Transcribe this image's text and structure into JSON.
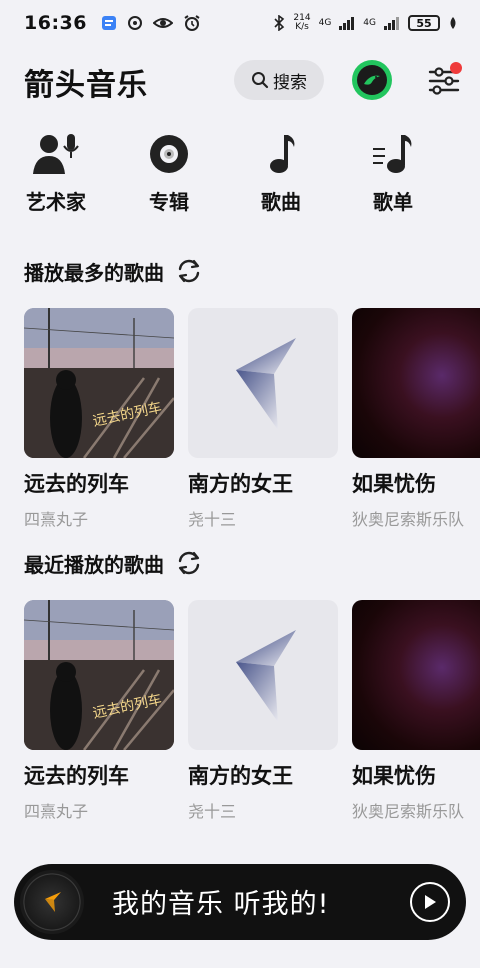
{
  "status_bar": {
    "time": "16:36",
    "net_speed_value": "214",
    "net_speed_unit": "K/s",
    "signal1": "4G",
    "signal2": "4G",
    "battery": "55"
  },
  "header": {
    "title": "箭头音乐",
    "search_label": "搜索"
  },
  "categories": [
    {
      "label": "艺术家",
      "icon": "artist-mic-icon"
    },
    {
      "label": "专辑",
      "icon": "album-disc-icon"
    },
    {
      "label": "歌曲",
      "icon": "music-note-icon"
    },
    {
      "label": "歌单",
      "icon": "playlist-icon"
    }
  ],
  "sections": [
    {
      "title": "播放最多的歌曲",
      "songs": [
        {
          "title": "远去的列车",
          "artist": "四熹丸子",
          "cover_text": "远去的列车"
        },
        {
          "title": "南方的女王",
          "artist": "尧十三"
        },
        {
          "title": "如果忧伤",
          "artist": "狄奥尼索斯乐队"
        }
      ]
    },
    {
      "title": "最近播放的歌曲",
      "songs": [
        {
          "title": "远去的列车",
          "artist": "四熹丸子",
          "cover_text": "远去的列车"
        },
        {
          "title": "南方的女王",
          "artist": "尧十三"
        },
        {
          "title": "如果忧伤",
          "artist": "狄奥尼索斯乐队"
        }
      ]
    }
  ],
  "player": {
    "text": "我的音乐 听我的!"
  },
  "colors": {
    "background": "#f2f2f6",
    "vip_green": "#22c55e",
    "notification_red": "#ef3b3b",
    "player_bg": "#111111"
  }
}
